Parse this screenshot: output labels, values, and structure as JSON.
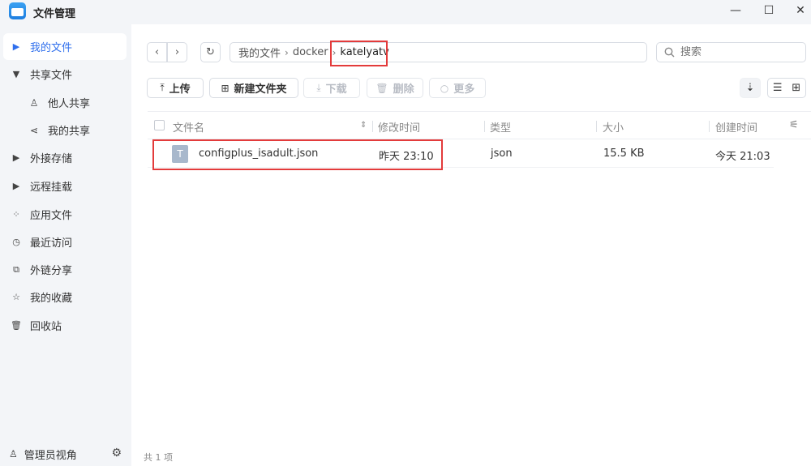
{
  "window": {
    "title": "文件管理",
    "controls": {
      "minimize": "—",
      "maximize": "☐",
      "close": "✕"
    }
  },
  "sidebar": {
    "items": [
      {
        "label": "我的文件",
        "icon": "caret-right-icon",
        "glyph": "▶",
        "active": true
      },
      {
        "label": "共享文件",
        "icon": "caret-down-icon",
        "glyph": "▼",
        "active": false
      },
      {
        "label": "他人共享",
        "icon": "person-icon",
        "glyph": "♙",
        "active": false
      },
      {
        "label": "我的共享",
        "icon": "share-icon",
        "glyph": "⋖",
        "active": false
      },
      {
        "label": "外接存储",
        "icon": "caret-right-icon",
        "glyph": "▶",
        "active": false
      },
      {
        "label": "远程挂载",
        "icon": "caret-right-icon",
        "glyph": "▶",
        "active": false
      },
      {
        "label": "应用文件",
        "icon": "grid-icon",
        "glyph": "⁘",
        "active": false
      },
      {
        "label": "最近访问",
        "icon": "clock-icon",
        "glyph": "◷",
        "active": false
      },
      {
        "label": "外链分享",
        "icon": "external-link-icon",
        "glyph": "⧉",
        "active": false
      },
      {
        "label": "我的收藏",
        "icon": "star-icon",
        "glyph": "☆",
        "active": false
      },
      {
        "label": "回收站",
        "icon": "trash-icon",
        "glyph": "🗑",
        "active": false
      }
    ],
    "footer": {
      "label": "管理员视角",
      "icon": "admin-icon",
      "glyph": "♙",
      "settings_glyph": "⚙"
    }
  },
  "nav": {
    "back_glyph": "‹",
    "forward_glyph": "›",
    "refresh_glyph": "↻"
  },
  "breadcrumb": {
    "items": [
      "我的文件",
      "docker",
      "katelyatv"
    ],
    "separator": "›"
  },
  "search": {
    "placeholder": "搜索",
    "value": ""
  },
  "toolbar": {
    "upload": "上传",
    "new_folder": "新建文件夹",
    "download": "下载",
    "delete": "删除",
    "more": "更多",
    "upload_glyph": "⤒",
    "new_folder_glyph": "⊞",
    "download_glyph": "⤓",
    "delete_glyph": "🗑",
    "more_glyph": "○",
    "sort_glyph": "⇣",
    "list_view_glyph": "☰",
    "grid_view_glyph": "⊞"
  },
  "table": {
    "columns": [
      "文件名",
      "修改时间",
      "类型",
      "大小",
      "创建时间"
    ],
    "sort_glyph": "⇕",
    "column_settings_glyph": "⚟",
    "rows": [
      {
        "name": "configplus_isadult.json",
        "modified": "昨天 23:10",
        "type": "json",
        "size": "15.5 KB",
        "created": "今天 21:03",
        "icon_glyph": "T"
      }
    ]
  },
  "status": {
    "count": "共 1 项"
  },
  "colors": {
    "accent": "#2f6fed",
    "highlight": "#e33b3b",
    "sidebar_bg": "#f3f5f8"
  }
}
